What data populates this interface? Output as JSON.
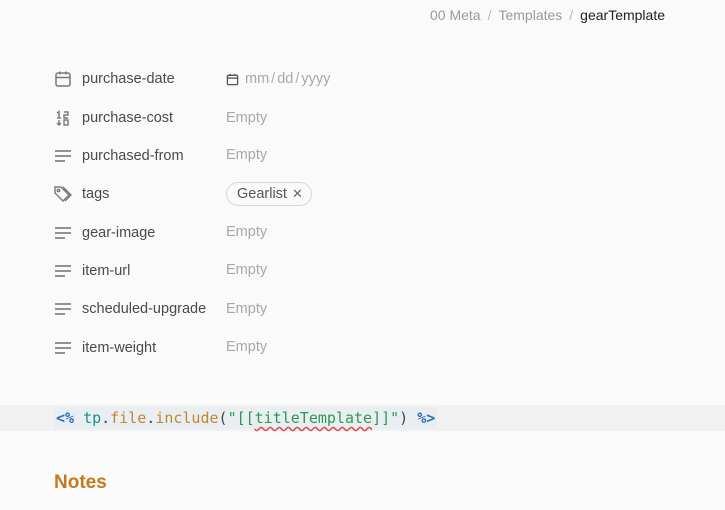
{
  "breadcrumb": {
    "items": [
      "00 Meta",
      "Templates",
      "gearTemplate"
    ]
  },
  "properties": [
    {
      "key": "purchase-date",
      "icon": "calendar-icon",
      "type": "date",
      "date": {
        "mm": "mm",
        "dd": "dd",
        "yyyy": "yyyy"
      }
    },
    {
      "key": "purchase-cost",
      "icon": "number-icon",
      "type": "text",
      "value": "Empty"
    },
    {
      "key": "purchased-from",
      "icon": "text-lines-icon",
      "type": "text",
      "value": "Empty"
    },
    {
      "key": "tags",
      "icon": "tags-icon",
      "type": "tags",
      "tags": [
        "Gearlist"
      ]
    },
    {
      "key": "gear-image",
      "icon": "text-lines-icon",
      "type": "text",
      "value": "Empty"
    },
    {
      "key": "item-url",
      "icon": "text-lines-icon",
      "type": "text",
      "value": "Empty"
    },
    {
      "key": "scheduled-upgrade",
      "icon": "text-lines-icon",
      "type": "text",
      "value": "Empty"
    },
    {
      "key": "item-weight",
      "icon": "text-lines-icon",
      "type": "text",
      "value": "Empty"
    }
  ],
  "code": {
    "open": "<%",
    "obj": "tp",
    "dot1": ".",
    "prop": "file",
    "dot2": ".",
    "fn": "include",
    "paren_open": "(",
    "quote_open": "\"",
    "bracket_open": "[[",
    "link": "titleTemplate",
    "bracket_close": "]]",
    "quote_close": "\"",
    "paren_close": ")",
    "close": "%>"
  },
  "notes_heading": "Notes",
  "colors": {
    "accent": "#c47a1a",
    "delimiter": "#2f6fb8",
    "string": "#2e9a4e"
  }
}
